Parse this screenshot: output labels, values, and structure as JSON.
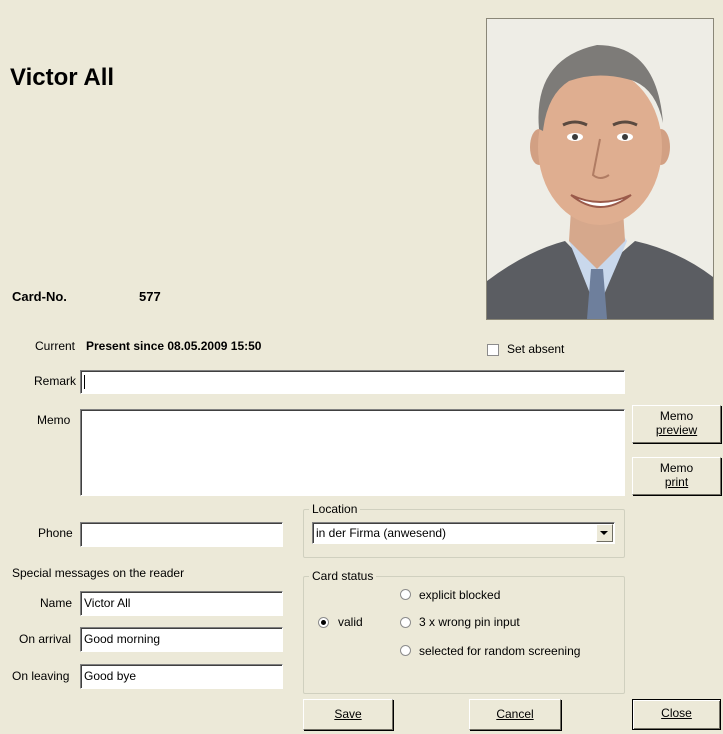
{
  "person": {
    "name": "Victor All"
  },
  "card": {
    "label": "Card-No.",
    "number": "577"
  },
  "current": {
    "label": "Current",
    "value": "Present since 08.05.2009 15:50"
  },
  "set_absent": {
    "label": "Set absent",
    "checked": false
  },
  "remark": {
    "label": "Remark",
    "value": ""
  },
  "memo": {
    "label": "Memo",
    "value": ""
  },
  "memo_preview_button": {
    "line1": "Memo",
    "line2": "preview"
  },
  "memo_print_button": {
    "line1": "Memo",
    "line2": "print"
  },
  "phone": {
    "label": "Phone",
    "value": ""
  },
  "location": {
    "legend": "Location",
    "selected": "in der Firma (anwesend)"
  },
  "special_messages": {
    "heading": "Special messages on the reader",
    "name_label": "Name",
    "name_value": "Victor All",
    "arrival_label": "On arrival",
    "arrival_value": "Good morning",
    "leaving_label": "On leaving",
    "leaving_value": "Good bye"
  },
  "card_status": {
    "legend": "Card status",
    "valid": "valid",
    "explicit_blocked": "explicit blocked",
    "wrong_pin": "3 x wrong pin input",
    "random_screening": "selected for random screening",
    "selected": "valid"
  },
  "buttons": {
    "save": "Save",
    "cancel": "Cancel",
    "close": "Close"
  },
  "colors": {
    "background": "#ece9d8",
    "input_border": "#7f9db9"
  }
}
